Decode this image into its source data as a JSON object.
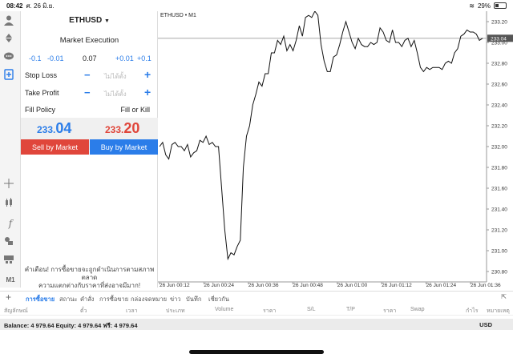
{
  "status": {
    "time": "08:42",
    "date": "ศ. 26 มิ.ย.",
    "battery": "29%",
    "battery_level": 0.29
  },
  "order": {
    "symbol": "ETHUSD",
    "execution_mode": "Market Execution",
    "volume_steps": [
      "-0.1",
      "-0.01",
      "0.07",
      "+0.01",
      "+0.1"
    ],
    "stop_loss": {
      "label": "Stop Loss",
      "value": "ไม่ได้ตั้ง"
    },
    "take_profit": {
      "label": "Take Profit",
      "value": "ไม่ได้ตั้ง"
    },
    "fill_policy": {
      "label": "Fill Policy",
      "value": "Fill or Kill"
    },
    "bid": {
      "small": "233.",
      "big": "04"
    },
    "ask": {
      "small": "233.",
      "big": "20"
    },
    "sell_label": "Sell by Market",
    "buy_label": "Buy by Market",
    "warning_line1": "คำเตือน! การซื้อขายจะถูกดำเนินการตามสภาพตลาด",
    "warning_line2": "ความแตกต่างกับราคาที่ส่งอาจมีมาก!"
  },
  "toolbar": {
    "timeframe_label": "M1"
  },
  "chart_data": {
    "type": "line",
    "title": "ETHUSD • M1",
    "y_ticks": [
      "233.20",
      "233.00",
      "232.80",
      "232.60",
      "232.40",
      "232.20",
      "232.00",
      "231.80",
      "231.60",
      "231.40",
      "231.20",
      "231.00",
      "230.80"
    ],
    "x_ticks": [
      "26 Jun 00:12",
      "26 Jun 00:24",
      "26 Jun 00:36",
      "26 Jun 00:48",
      "26 Jun 01:00",
      "26 Jun 01:12",
      "26 Jun 01:24",
      "26 Jun 01:36"
    ],
    "ylim": [
      230.7,
      233.3
    ],
    "current_price": "233.04",
    "current_value": 233.04,
    "series": [
      {
        "values": [
          232.0,
          232.04,
          231.92,
          231.88,
          232.02,
          232.04,
          232.0,
          232.0,
          231.96,
          232.02,
          231.9,
          231.94,
          231.96,
          232.06,
          232.04,
          232.1,
          232.02,
          232.04,
          232.0,
          232.0,
          231.6,
          231.2,
          230.92,
          230.98,
          230.96,
          231.04,
          231.1,
          231.8,
          232.1,
          232.2,
          232.4,
          232.5,
          232.62,
          232.58,
          232.7,
          232.7,
          232.9,
          232.9,
          233.02,
          232.98,
          233.06,
          232.92,
          232.98,
          232.92,
          233.02,
          233.16,
          233.06,
          233.24,
          233.26,
          233.24,
          233.3,
          233.26,
          232.98,
          232.82,
          232.72,
          232.72,
          232.86,
          232.88,
          232.98,
          233.1,
          233.2,
          233.1,
          233.0,
          232.94,
          233.04,
          232.98,
          232.96,
          232.96,
          233.0,
          232.98,
          233.0,
          233.14,
          233.1,
          233.02,
          233.0,
          233.12,
          233.0,
          233.0,
          232.96,
          233.02,
          233.04,
          232.96,
          233.02,
          232.9,
          232.76,
          232.72,
          232.76,
          232.74,
          232.76,
          232.76,
          232.76,
          232.74,
          232.8,
          232.82,
          232.8,
          232.9,
          232.94,
          233.06,
          233.08,
          233.12,
          233.1,
          233.1,
          233.08,
          233.02,
          233.04
        ]
      }
    ]
  },
  "tabs": [
    "การซื้อขาย",
    "สถานะ",
    "คำสั่ง",
    "การซื้อขาย",
    "กล่องจดหมาย",
    "ข่าว",
    "บันทึก",
    "เชี่ยวกัน"
  ],
  "columns": [
    "สัญลักษณ์",
    "ตั๋ว",
    "เวลา",
    "ประเภท",
    "Volume",
    "ราคา",
    "S/L",
    "T/P",
    "ราคา",
    "Swap",
    "กำไร",
    "หมายเหตุ"
  ],
  "balance": {
    "text": "Balance: 4 979.64 Equity: 4 979.64 ฟรี: 4 979.64",
    "currency": "USD"
  }
}
